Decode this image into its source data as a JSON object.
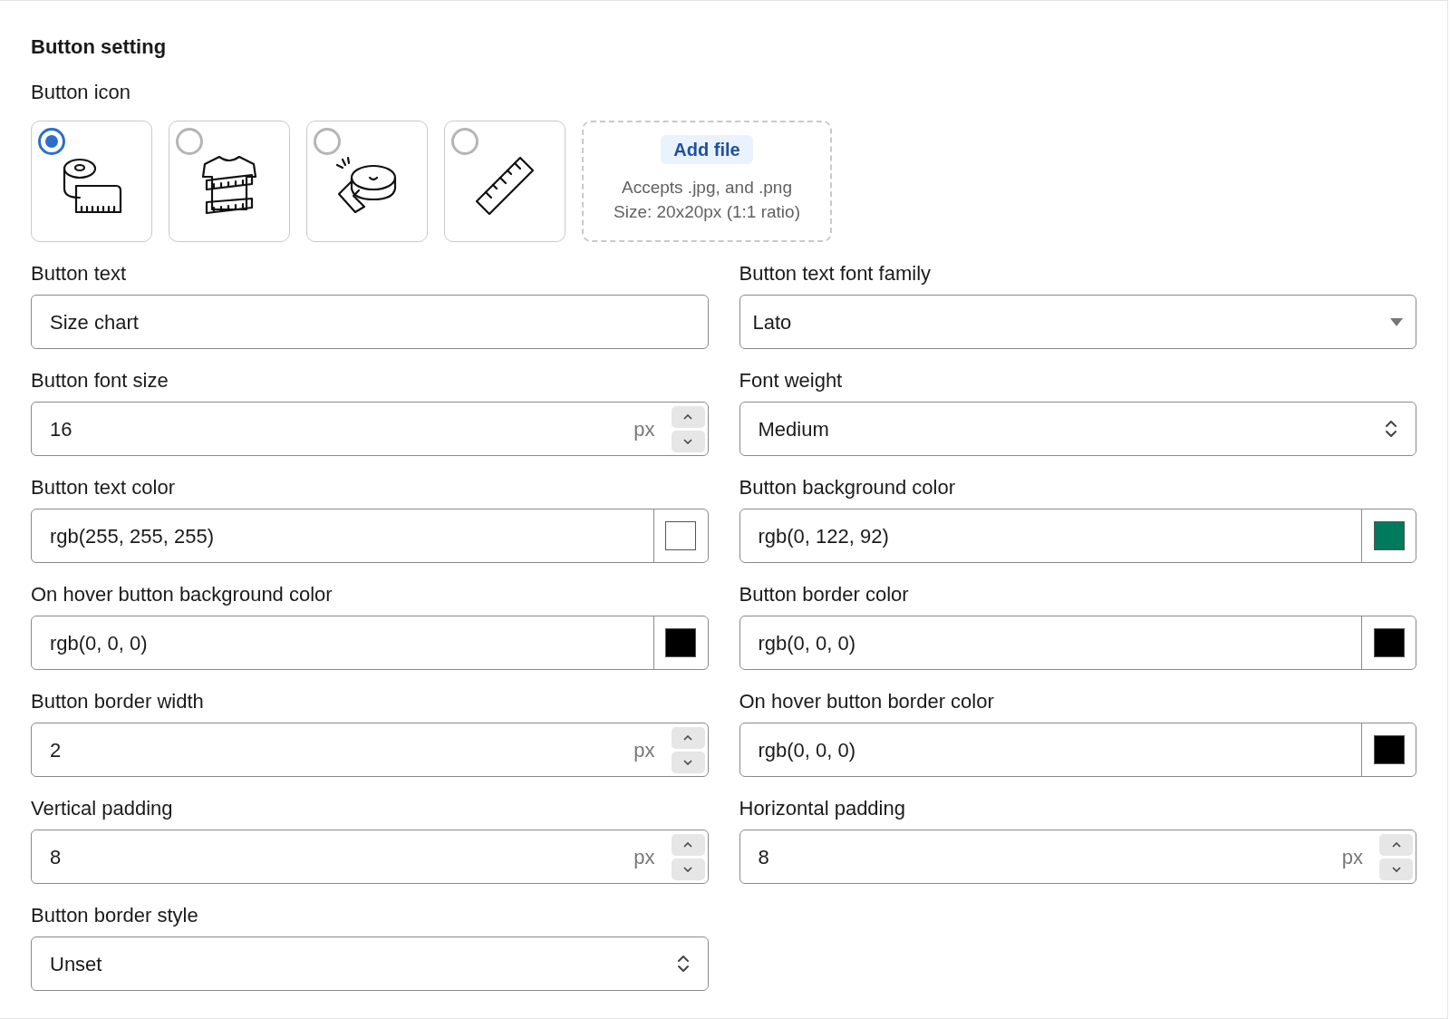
{
  "section_title": "Button setting",
  "icon_picker": {
    "label": "Button icon",
    "options": [
      {
        "kind": "tape-roll",
        "selected": true
      },
      {
        "kind": "shirt",
        "selected": false
      },
      {
        "kind": "tape-coil",
        "selected": false
      },
      {
        "kind": "ruler",
        "selected": false
      }
    ],
    "upload": {
      "button": "Add file",
      "hint_lines": [
        "Accepts .jpg, and .png",
        "Size: 20x20px (1:1 ratio)"
      ]
    }
  },
  "fields": [
    {
      "kind": "text",
      "label": "Button text",
      "value": "Size chart"
    },
    {
      "kind": "dropdown",
      "label": "Button text font family",
      "value": "Lato"
    },
    {
      "kind": "number",
      "label": "Button font size",
      "value": "16",
      "unit": "px"
    },
    {
      "kind": "select",
      "label": "Font weight",
      "value": "Medium"
    },
    {
      "kind": "color",
      "label": "Button text color",
      "value": "rgb(255, 255, 255)",
      "color": "#ffffff"
    },
    {
      "kind": "color",
      "label": "Button background color",
      "value": "rgb(0, 122, 92)",
      "color": "#007a5c"
    },
    {
      "kind": "color",
      "label": "On hover button background color",
      "value": "rgb(0, 0, 0)",
      "color": "#000000"
    },
    {
      "kind": "color",
      "label": "Button border color",
      "value": "rgb(0, 0, 0)",
      "color": "#000000"
    },
    {
      "kind": "number",
      "label": "Button border width",
      "value": "2",
      "unit": "px"
    },
    {
      "kind": "color",
      "label": "On hover button border color",
      "value": "rgb(0, 0, 0)",
      "color": "#000000"
    },
    {
      "kind": "number",
      "label": "Vertical padding",
      "value": "8",
      "unit": "px"
    },
    {
      "kind": "number",
      "label": "Horizontal padding",
      "value": "8",
      "unit": "px"
    },
    {
      "kind": "select",
      "label": "Button border style",
      "value": "Unset"
    }
  ]
}
